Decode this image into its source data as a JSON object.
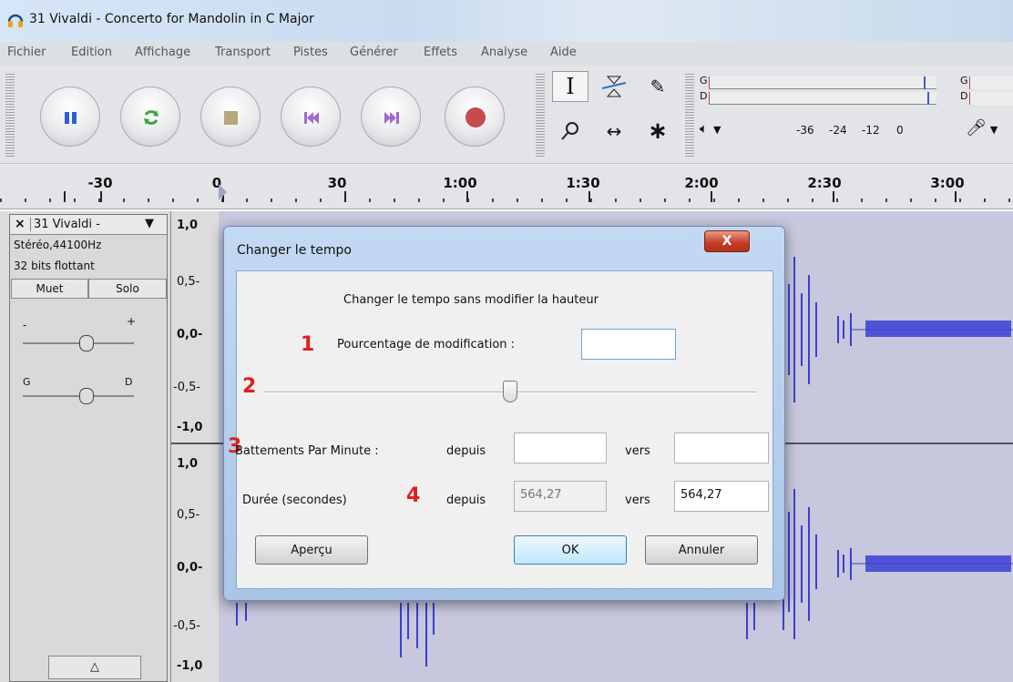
{
  "window": {
    "title": "31 Vivaldi - Concerto for Mandolin in C Major"
  },
  "menu": [
    "Fichier",
    "Edition",
    "Affichage",
    "Transport",
    "Pistes",
    "Générer",
    "Effets",
    "Analyse",
    "Aide"
  ],
  "meters": {
    "left_label": "G",
    "right_label": "D",
    "scale": [
      "-36",
      "-24",
      "-12",
      "0"
    ]
  },
  "ruler": [
    "-30",
    "0",
    "30",
    "1:00",
    "1:30",
    "2:00",
    "2:30",
    "3:00"
  ],
  "track": {
    "name": "31 Vivaldi -",
    "format": "Stéréo,44100Hz",
    "bits": "32 bits flottant",
    "mute": "Muet",
    "solo": "Solo",
    "gain_minus": "-",
    "gain_plus": "+",
    "pan_left": "G",
    "pan_right": "D"
  },
  "scale_top": [
    "1,0",
    "0,5-",
    "0,0-",
    "-0,5-",
    "-1,0"
  ],
  "scale_bottom": [
    "1,0",
    "0,5-",
    "0,0-",
    "-0,5-",
    "-1,0"
  ],
  "dialog": {
    "title": "Changer le tempo",
    "close": "X",
    "heading": "Changer le tempo sans modifier la hauteur",
    "markers": [
      "1",
      "2",
      "3",
      "4"
    ],
    "percent_label": "Pourcentage de modification :",
    "percent_value": "",
    "slider_value": 0.5,
    "bpm_label": "Battements Par Minute :",
    "from_label": "depuis",
    "to_label": "vers",
    "bpm_from": "",
    "bpm_to": "",
    "duration_label": "Durée (secondes)",
    "duration_from": "564,27",
    "duration_to": "564,27",
    "preview": "Aperçu",
    "ok": "OK",
    "cancel": "Annuler"
  },
  "colors": {
    "waveform": "#3a3fd4",
    "accent": "#3c7fb1",
    "record": "#c94a4a"
  }
}
